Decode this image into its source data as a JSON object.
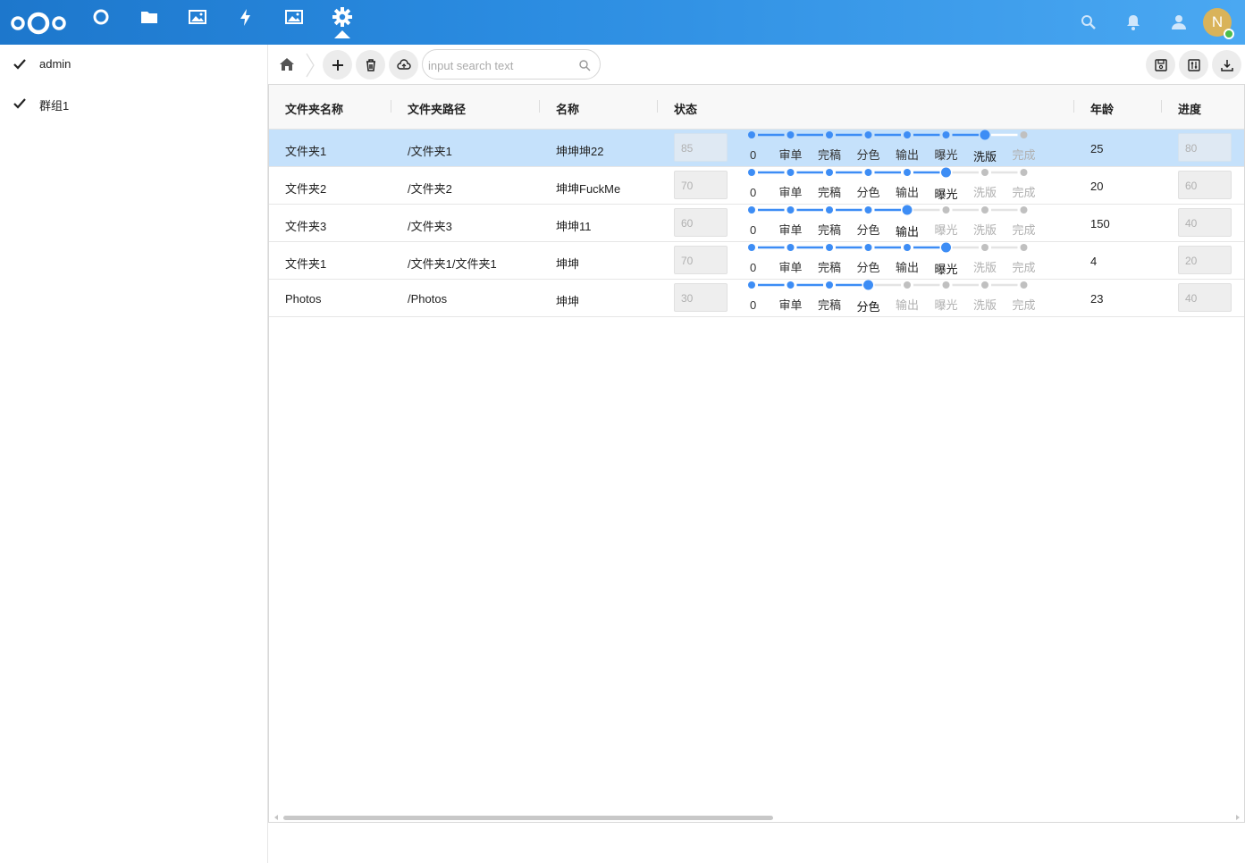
{
  "colors": {
    "topbar_start": "#1d77cc",
    "topbar_end": "#4aa8f2",
    "selected_row": "#c5e1fb",
    "step_active": "#3d8df5",
    "step_inactive": "#c0c0c0",
    "avatar_bg": "#d9b35a",
    "status_online": "#4bbd4b"
  },
  "topbar": {
    "apps": [
      "dashboard-icon",
      "files-icon",
      "photos-icon",
      "activity-icon",
      "gallery-icon",
      "settings-icon"
    ],
    "active_app": "settings-icon",
    "avatar_initial": "N"
  },
  "sidebar": {
    "items": [
      {
        "label": "admin",
        "checked": true
      },
      {
        "label": "群组1",
        "checked": true
      }
    ]
  },
  "toolbar": {
    "search_placeholder": "input search text"
  },
  "table": {
    "columns": [
      "文件夹名称",
      "文件夹路径",
      "名称",
      "状态",
      "年龄",
      "进度"
    ],
    "step_labels": [
      "0",
      "审单",
      "完稿",
      "分色",
      "输出",
      "曝光",
      "洗版",
      "完成"
    ],
    "rows": [
      {
        "folder": "文件夹1",
        "path": "/文件夹1",
        "name": "坤坤坤22",
        "status": "85",
        "step": 6,
        "age": "25",
        "progress": "80",
        "selected": true
      },
      {
        "folder": "文件夹2",
        "path": "/文件夹2",
        "name": "坤坤FuckMe",
        "status": "70",
        "step": 5,
        "age": "20",
        "progress": "60",
        "selected": false
      },
      {
        "folder": "文件夹3",
        "path": "/文件夹3",
        "name": "坤坤11",
        "status": "60",
        "step": 4,
        "age": "150",
        "progress": "40",
        "selected": false
      },
      {
        "folder": "文件夹1",
        "path": "/文件夹1/文件夹1",
        "name": "坤坤",
        "status": "70",
        "step": 5,
        "age": "4",
        "progress": "20",
        "selected": false
      },
      {
        "folder": "Photos",
        "path": "/Photos",
        "name": "坤坤",
        "status": "30",
        "step": 3,
        "age": "23",
        "progress": "40",
        "selected": false
      }
    ]
  }
}
